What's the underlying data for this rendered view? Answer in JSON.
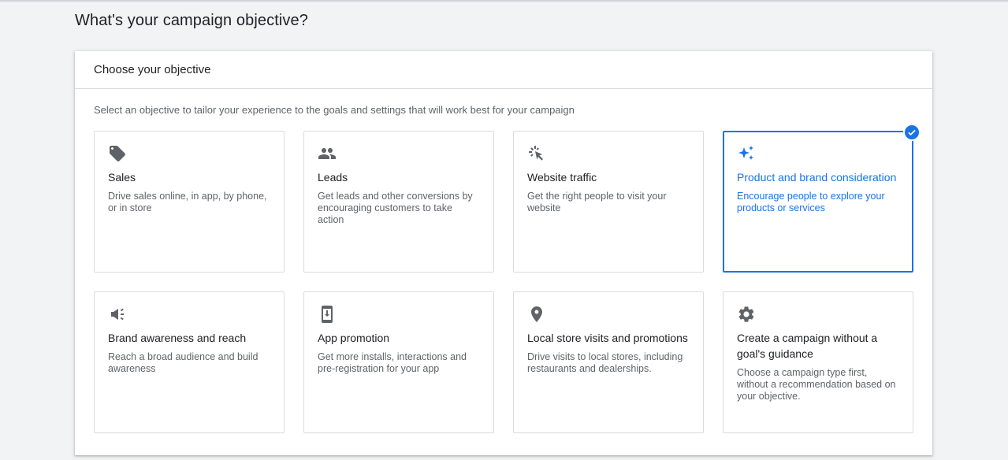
{
  "page_title": "What's your campaign objective?",
  "card": {
    "header": "Choose your objective",
    "subtitle": "Select an objective to tailor your experience to the goals and settings that will work best for your campaign"
  },
  "objectives": [
    {
      "title": "Sales",
      "desc": "Drive sales online, in app, by phone, or in store",
      "icon": "tag-icon",
      "selected": false
    },
    {
      "title": "Leads",
      "desc": "Get leads and other conversions by encouraging customers to take action",
      "icon": "people-icon",
      "selected": false
    },
    {
      "title": "Website traffic",
      "desc": "Get the right people to visit your website",
      "icon": "cursor-click-icon",
      "selected": false
    },
    {
      "title": "Product and brand consideration",
      "desc": "Encourage people to explore your products or services",
      "icon": "sparkle-icon",
      "selected": true
    },
    {
      "title": "Brand awareness and reach",
      "desc": "Reach a broad audience and build awareness",
      "icon": "megaphone-icon",
      "selected": false
    },
    {
      "title": "App promotion",
      "desc": "Get more installs, interactions and pre-registration for your app",
      "icon": "phone-icon",
      "selected": false
    },
    {
      "title": "Local store visits and promotions",
      "desc": "Drive visits to local stores, including restaurants and dealerships.",
      "icon": "location-pin-icon",
      "selected": false
    },
    {
      "title": "Create a campaign without a goal's guidance",
      "desc": "Choose a campaign type first, without a recommendation based on your objective.",
      "icon": "gear-icon",
      "selected": false
    }
  ],
  "colors": {
    "accent": "#1a73e8",
    "icon": "#5f6368",
    "border": "#dadce0"
  }
}
